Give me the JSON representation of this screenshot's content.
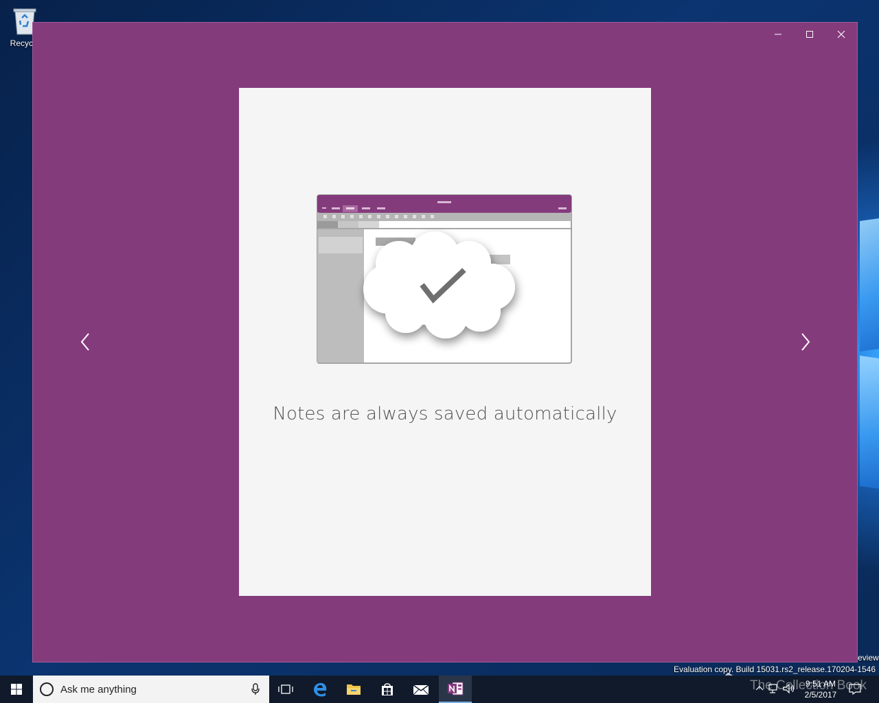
{
  "desktop": {
    "recycle_bin_label": "Recycle"
  },
  "window": {
    "minimize_label": "Minimize",
    "maximize_label": "Maximize",
    "close_label": "Close"
  },
  "slide": {
    "caption": "Notes are always saved automatically"
  },
  "watermark": {
    "preview_fragment": "eview",
    "evaluation": "Evaluation copy. Build 15031.rs2_release.170204-1546",
    "site_name": "The Collection Book"
  },
  "taskbar": {
    "search_placeholder": "Ask me anything",
    "clock_time": "9:51 AM",
    "clock_date": "2/5/2017"
  },
  "colors": {
    "app_accent": "#843b7c",
    "card_background": "#f5f5f5",
    "taskbar": "#101a2a"
  },
  "icons": [
    "recycle-bin-icon",
    "minimize-icon",
    "maximize-icon",
    "close-icon",
    "chevron-left-icon",
    "chevron-right-icon",
    "windows-start-icon",
    "cortana-circle-icon",
    "microphone-icon",
    "task-view-icon",
    "edge-icon",
    "file-explorer-icon",
    "store-icon",
    "mail-icon",
    "onenote-icon",
    "chevron-up-icon",
    "network-icon",
    "volume-icon",
    "notifications-icon"
  ]
}
